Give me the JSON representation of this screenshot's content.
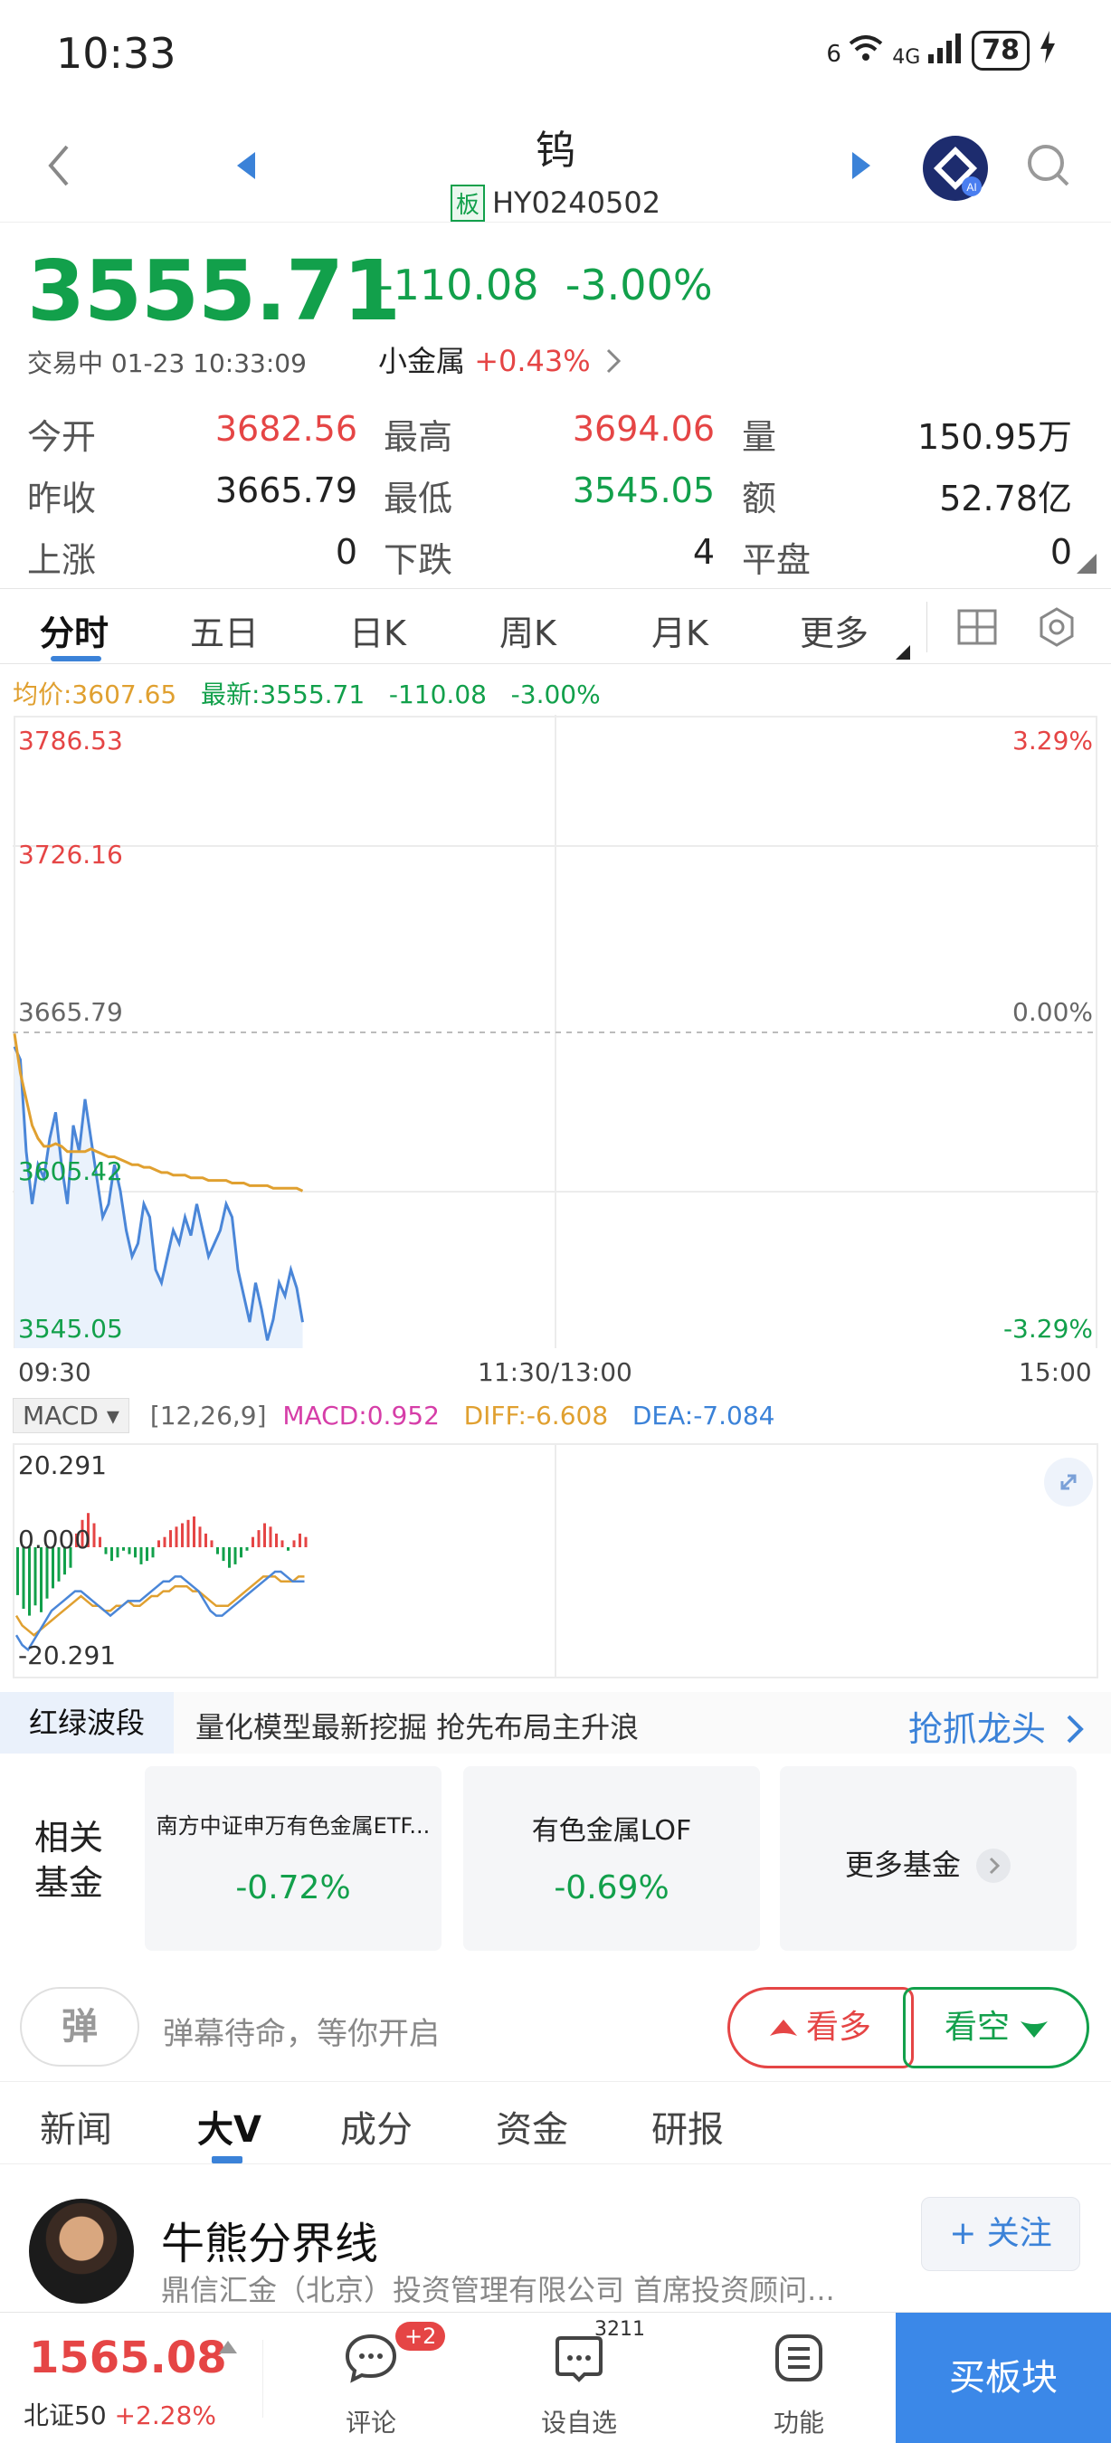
{
  "status_bar": {
    "time": "10:33",
    "network": "6",
    "signal": "4G",
    "battery": "78"
  },
  "nav": {
    "title": "钨",
    "board_tag": "板",
    "code": "HY0240502"
  },
  "quote": {
    "price": "3555.71",
    "change": "-110.08",
    "change_pct": "-3.00%",
    "status": "交易中 01-23 10:33:09",
    "sector_name": "小金属",
    "sector_change": "+0.43%"
  },
  "stats": {
    "open_label": "今开",
    "open": "3682.56",
    "high_label": "最高",
    "high": "3694.06",
    "vol_label": "量",
    "vol": "150.95万",
    "prev_label": "昨收",
    "prev": "3665.79",
    "low_label": "最低",
    "low": "3545.05",
    "amt_label": "额",
    "amt": "52.78亿",
    "up_label": "上涨",
    "up": "0",
    "down_label": "下跌",
    "down": "4",
    "flat_label": "平盘",
    "flat": "0"
  },
  "tabs": [
    "分时",
    "五日",
    "日K",
    "周K",
    "月K",
    "更多"
  ],
  "legend": {
    "avg": "均价:3607.65",
    "last": "最新:3555.71",
    "chg": "-110.08",
    "pct": "-3.00%"
  },
  "chart_data": {
    "type": "line",
    "y_labels": [
      "3786.53",
      "3726.16",
      "3665.79",
      "3605.42",
      "3545.05"
    ],
    "pct_labels": [
      "3.29%",
      "0.00%",
      "-3.29%"
    ],
    "x_labels": [
      "09:30",
      "11:30/13:00",
      "15:00"
    ],
    "ylim": [
      3545.05,
      3786.53
    ],
    "series": [
      {
        "name": "最新",
        "color": "#4a86d8",
        "values": [
          3660,
          3655,
          3620,
          3600,
          3615,
          3610,
          3625,
          3635,
          3615,
          3600,
          3630,
          3620,
          3640,
          3625,
          3610,
          3595,
          3600,
          3615,
          3605,
          3590,
          3580,
          3585,
          3600,
          3595,
          3575,
          3570,
          3580,
          3590,
          3585,
          3595,
          3588,
          3600,
          3590,
          3580,
          3585,
          3590,
          3600,
          3595,
          3575,
          3565,
          3555,
          3570,
          3560,
          3548,
          3556,
          3570,
          3565,
          3575,
          3568,
          3555
        ]
      },
      {
        "name": "均价",
        "color": "#e0a030",
        "values": [
          3665,
          3650,
          3640,
          3630,
          3625,
          3622,
          3622,
          3623,
          3622,
          3620,
          3620,
          3620,
          3620,
          3621,
          3620,
          3619,
          3618,
          3618,
          3617,
          3616,
          3615,
          3615,
          3614,
          3614,
          3613,
          3612,
          3612,
          3611,
          3611,
          3611,
          3610,
          3610,
          3610,
          3609,
          3609,
          3609,
          3609,
          3608,
          3608,
          3608,
          3607,
          3607,
          3607,
          3607,
          3606,
          3606,
          3606,
          3606,
          3606,
          3605
        ]
      }
    ]
  },
  "macd": {
    "selector": "MACD",
    "params": "[12,26,9]",
    "macd": "MACD:0.952",
    "diff": "DIFF:-6.608",
    "dea": "DEA:-7.084",
    "y_top": "20.291",
    "y_mid": "0.000",
    "y_bot": "-20.291",
    "bars": [
      -14,
      -18,
      -20,
      -17,
      -19,
      -15,
      -12,
      -10,
      -8,
      -6,
      4,
      8,
      10,
      7,
      3,
      -2,
      -4,
      -3,
      -1,
      -2,
      -3,
      -5,
      -4,
      -3,
      2,
      3,
      5,
      6,
      7,
      8,
      9,
      6,
      4,
      2,
      -2,
      -4,
      -6,
      -5,
      -3,
      -1,
      3,
      5,
      7,
      6,
      4,
      2,
      -1,
      2,
      4,
      3
    ],
    "diff_line": [
      -14,
      -16,
      -17,
      -18,
      -17,
      -16,
      -15,
      -14,
      -13,
      -12,
      -11,
      -10,
      -11,
      -12,
      -12,
      -13,
      -13,
      -12,
      -12,
      -11,
      -12,
      -12,
      -11,
      -10,
      -10,
      -9,
      -9,
      -8,
      -8,
      -8,
      -9,
      -9,
      -10,
      -11,
      -12,
      -12,
      -12,
      -11,
      -10,
      -9,
      -8,
      -7,
      -6,
      -6,
      -6,
      -7,
      -7,
      -7,
      -6,
      -6
    ],
    "dea_line": [
      -18,
      -20,
      -21,
      -19,
      -17,
      -15,
      -13,
      -12,
      -11,
      -10,
      -9,
      -9,
      -10,
      -11,
      -12,
      -13,
      -14,
      -13,
      -12,
      -11,
      -11,
      -11,
      -10,
      -9,
      -8,
      -7,
      -7,
      -6,
      -6,
      -7,
      -8,
      -9,
      -11,
      -13,
      -14,
      -14,
      -13,
      -12,
      -11,
      -10,
      -9,
      -8,
      -7,
      -6,
      -5,
      -5,
      -6,
      -7,
      -7,
      -7
    ]
  },
  "promo": {
    "tag": "红绿波段",
    "text": "量化模型最新挖掘 抢先布局主升浪",
    "cta": "抢抓龙头"
  },
  "funds": {
    "label_1": "相关",
    "label_2": "基金",
    "items": [
      {
        "name": "南方中证申万有色金属ETF...",
        "change": "-0.72%"
      },
      {
        "name": "有色金属LOF",
        "change": "-0.69%"
      }
    ],
    "more": "更多基金"
  },
  "danmu": {
    "btn": "弹",
    "placeholder": "弹幕待命，等你开启",
    "bull": "看多",
    "bear": "看空"
  },
  "news_tabs": [
    "新闻",
    "大V",
    "成分",
    "资金",
    "研报"
  ],
  "author": {
    "name": "牛熊分界线",
    "desc": "鼎信汇金（北京）投资管理有限公司 首席投资顾问...",
    "follow": "+ 关注"
  },
  "bottom": {
    "index_price": "1565.08",
    "index_name": "北证50",
    "index_chg": "+2.28%",
    "comment": "评论",
    "comment_badge": "+2",
    "watch": "设自选",
    "watch_count": "3211",
    "func": "功能",
    "buy": "买板块"
  }
}
